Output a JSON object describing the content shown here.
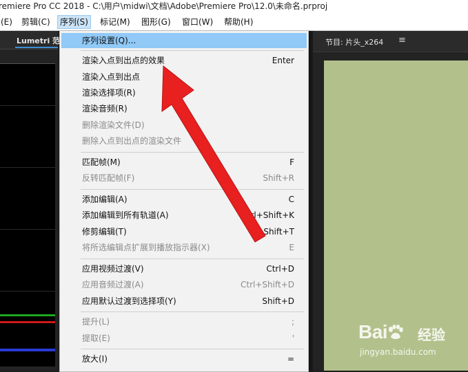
{
  "window": {
    "title": "remiere Pro CC 2018 - C:\\用户\\midwi\\文档\\Adobe\\Premiere Pro\\12.0\\未命名.prproj"
  },
  "menubar": {
    "items": [
      "(E)",
      "剪辑(C)",
      "序列(S)",
      "标记(M)",
      "图形(G)",
      "窗口(W)",
      "帮助(H)"
    ],
    "active": "序列(S)"
  },
  "left_panel": {
    "tab_label": "Lumetri 范"
  },
  "right_panel": {
    "tab_label": "节目: 片头_x264",
    "menu_glyph": "≡"
  },
  "dropdown": {
    "items": [
      {
        "label": "序列设置(Q)...",
        "shortcut": "",
        "disabled": false,
        "highlight": true
      },
      {
        "label": "渲染入点到出点的效果",
        "shortcut": "Enter",
        "disabled": false,
        "highlight": false
      },
      {
        "label": "渲染入点到出点",
        "shortcut": "",
        "disabled": false,
        "highlight": false
      },
      {
        "label": "渲染选择项(R)",
        "shortcut": "",
        "disabled": false,
        "highlight": false
      },
      {
        "label": "渲染音频(R)",
        "shortcut": "",
        "disabled": false,
        "highlight": false
      },
      {
        "label": "删除渲染文件(D)",
        "shortcut": "",
        "disabled": true,
        "highlight": false
      },
      {
        "label": "删除入点到出点的渲染文件",
        "shortcut": "",
        "disabled": true,
        "highlight": false
      },
      {
        "label": "匹配帧(M)",
        "shortcut": "F",
        "disabled": false,
        "highlight": false
      },
      {
        "label": "反转匹配帧(F)",
        "shortcut": "Shift+R",
        "disabled": true,
        "highlight": false
      },
      {
        "label": "添加编辑(A)",
        "shortcut": "C",
        "disabled": false,
        "highlight": false
      },
      {
        "label": "添加编辑到所有轨道(A)",
        "shortcut": "Ctrl+Shift+K",
        "disabled": false,
        "highlight": false
      },
      {
        "label": "修剪编辑(T)",
        "shortcut": "Shift+T",
        "disabled": false,
        "highlight": false
      },
      {
        "label": "将所选编辑点扩展到播放指示器(X)",
        "shortcut": "E",
        "disabled": true,
        "highlight": false
      },
      {
        "label": "应用视频过渡(V)",
        "shortcut": "Ctrl+D",
        "disabled": false,
        "highlight": false
      },
      {
        "label": "应用音频过渡(A)",
        "shortcut": "Ctrl+Shift+D",
        "disabled": true,
        "highlight": false
      },
      {
        "label": "应用默认过渡到选择项(Y)",
        "shortcut": "Shift+D",
        "disabled": false,
        "highlight": false
      },
      {
        "label": "提升(L)",
        "shortcut": ";",
        "disabled": true,
        "highlight": false
      },
      {
        "label": "提取(E)",
        "shortcut": "'",
        "disabled": true,
        "highlight": false
      },
      {
        "label": "放大(I)",
        "shortcut": "=",
        "disabled": false,
        "highlight": false
      }
    ]
  },
  "watermark": {
    "brand_prefix": "Bai",
    "brand_suffix": "经验",
    "url": "jingyan.baidu.com"
  },
  "colors": {
    "highlight": "#91c9f7",
    "monitor": "#b2c18b",
    "arrow": "#e8201f"
  },
  "icons": {
    "panel_menu": "hamburger-menu-icon",
    "annotation": "red-arrow-icon",
    "watermark": "baidu-paw-icon"
  }
}
